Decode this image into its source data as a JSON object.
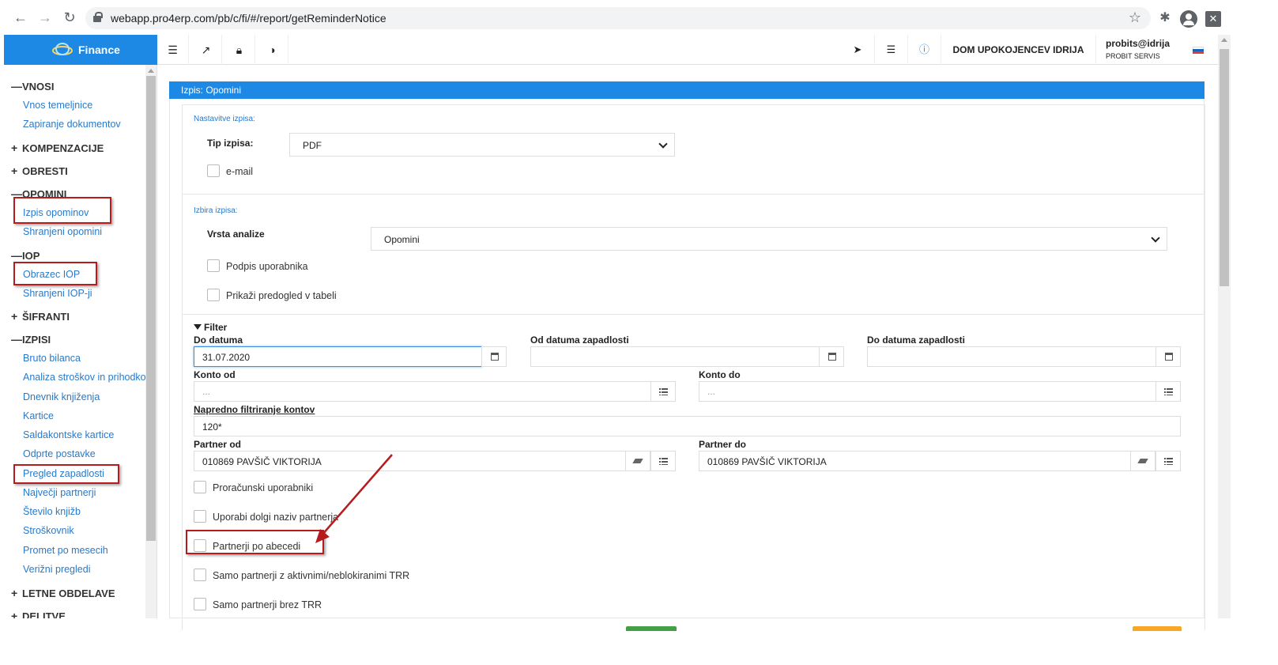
{
  "browser": {
    "url": "webapp.pro4erp.com/pb/c/fi/#/report/getReminderNotice"
  },
  "app": {
    "title": "Finance",
    "company": "DOM UPOKOJENCEV IDRIJA",
    "user": "probits@idrija",
    "organization": "PROBIT SERVIS"
  },
  "sidebar": {
    "sections": [
      {
        "sym": "—",
        "label": "VNOSI"
      },
      {
        "sym": "+",
        "label": "KOMPENZACIJE"
      },
      {
        "sym": "+",
        "label": "OBRESTI"
      },
      {
        "sym": "—",
        "label": "OPOMINI"
      },
      {
        "sym": "—",
        "label": "IOP"
      },
      {
        "sym": "+",
        "label": "ŠIFRANTI"
      },
      {
        "sym": "—",
        "label": "IZPISI"
      },
      {
        "sym": "+",
        "label": "LETNE OBDELAVE"
      },
      {
        "sym": "+",
        "label": "DELITVE"
      }
    ],
    "items": [
      "Vnos temeljnice",
      "Zapiranje dokumentov",
      "Izpis opominov",
      "Shranjeni opomini",
      "Obrazec IOP",
      "Shranjeni IOP-ji",
      "Bruto bilanca",
      "Analiza stroškov in prihodkov",
      "Dnevnik knjiženja",
      "Kartice",
      "Saldakontske kartice",
      "Odprte postavke",
      "Pregled zapadlosti",
      "Največji partnerji",
      "Število knjižb",
      "Stroškovnik",
      "Promet po mesecih",
      "Verižni pregledi"
    ]
  },
  "panel": {
    "title": "Izpis: Opomini",
    "settings": {
      "section_label": "Nastavitve izpisa:",
      "type_label": "Tip izpisa:",
      "type_value": "PDF",
      "email_label": "e-mail"
    },
    "selection": {
      "section_label": "Izbira izpisa:",
      "analysis_label": "Vrsta analize",
      "analysis_value": "Opomini",
      "signature_label": "Podpis uporabnika",
      "preview_label": "Prikaži predogled v tabeli"
    },
    "filter": {
      "title": "Filter",
      "date_to_label": "Do datuma",
      "date_to_value": "31.07.2020",
      "due_from_label": "Od datuma zapadlosti",
      "due_to_label": "Do datuma zapadlosti",
      "konto_from_label": "Konto od",
      "konto_to_label": "Konto do",
      "konto_placeholder": "...",
      "advanced_label": "Napredno filtriranje kontov",
      "advanced_value": "120*",
      "partner_from_label": "Partner od",
      "partner_from_value": "010869 PAVŠIČ VIKTORIJA",
      "partner_to_label": "Partner do",
      "partner_to_value": "010869 PAVŠIČ VIKTORIJA",
      "cb_budget": "Proračunski uporabniki",
      "cb_longname": "Uporabi dolgi naziv partnerja",
      "cb_alpha": "Partnerji po abecedi",
      "cb_active_trr": "Samo partnerji z aktivnimi/neblokiranimi TRR",
      "cb_no_trr": "Samo partnerji brez TRR"
    }
  },
  "colors": {
    "brand": "#1e88e5",
    "link": "#2979c8",
    "highlight": "#b71c1c"
  }
}
